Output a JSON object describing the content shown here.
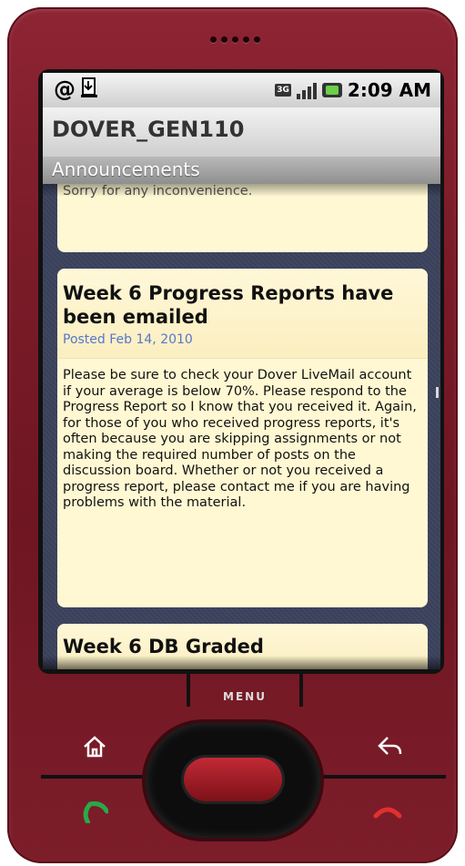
{
  "status_bar": {
    "time": "2:09 AM",
    "network_label": "3G",
    "icons": [
      "at-sign-icon",
      "download-icon",
      "3g-icon",
      "signal-bars-icon",
      "battery-charging-icon"
    ]
  },
  "app": {
    "title": "DOVER_GEN110",
    "section": "Announcements"
  },
  "announcements": [
    {
      "title": "",
      "date": "",
      "body": "Sorry for any inconvenience."
    },
    {
      "title": "Week 6 Progress Reports have been emailed",
      "date": "Posted Feb 14, 2010",
      "body": "Please be sure to check your Dover LiveMail account if your average is below 70%.  Please respond to the Progress Report so I know that you received it.  Again, for those of you who received progress reports, it's often because you are skipping assignments or not making the required number of posts on the discussion board.  Whether or not you received a progress report, please contact me if you are having problems with the material."
    },
    {
      "title": "Week 6 DB Graded",
      "date": "",
      "body": ""
    }
  ],
  "hardware": {
    "menu_label": "MENU",
    "buttons": [
      "home-icon",
      "back-icon",
      "call-icon",
      "end-call-icon",
      "trackball"
    ]
  },
  "colors": {
    "phone_body": "#7a1b28",
    "card_bg": "#fff8d3",
    "date_link": "#5577cc",
    "screen_bg": "#39405a"
  }
}
